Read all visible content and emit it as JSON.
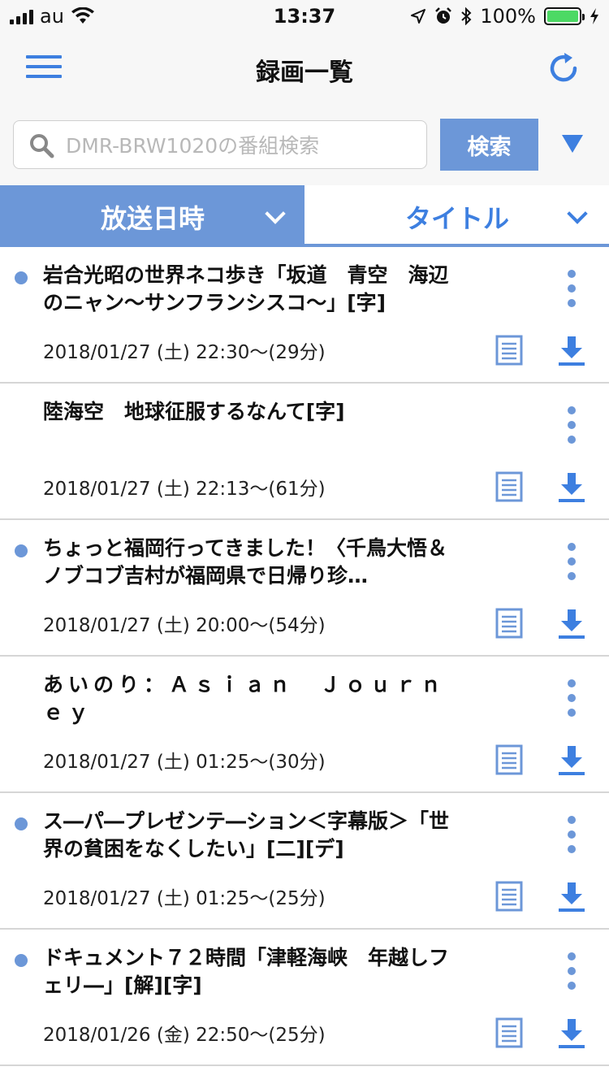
{
  "status": {
    "carrier": "au",
    "time": "13:37",
    "battery": "100%",
    "battery_level": 1.0
  },
  "nav": {
    "title": "録画一覧"
  },
  "search": {
    "placeholder": "DMR-BRW1020の番組検索",
    "button_label": "検索"
  },
  "sort": {
    "primary_label": "放送日時",
    "secondary_label": "タイトル"
  },
  "colors": {
    "accent": "#6c97d8",
    "icon_blue": "#3d7fe0",
    "battery_green": "#4cd964"
  },
  "recordings": [
    {
      "title": "岩合光昭の世界ネコ歩き「坂道　青空　海辺のニャン〜サンフランシスコ〜」[字]",
      "date": "2018/01/27 (土)  22:30〜(29分)",
      "unwatched": true
    },
    {
      "title": "陸海空　地球征服するなんて[字]",
      "date": "2018/01/27 (土)  22:13〜(61分)",
      "unwatched": false
    },
    {
      "title": "ちょっと福岡行ってきました！〈千鳥大悟＆ノブコブ吉村が福岡県で日帰り珍…",
      "date": "2018/01/27 (土)  20:00〜(54分)",
      "unwatched": true
    },
    {
      "title": "あいのり：Ａｓｉａｎ　Ｊｏｕｒｎｅｙ",
      "date": "2018/01/27 (土)  01:25〜(30分)",
      "unwatched": false
    },
    {
      "title": "ス―パ―プレゼンテ―ション＜字幕版＞「世界の貧困をなくしたい」[二][デ]",
      "date": "2018/01/27 (土)  01:25〜(25分)",
      "unwatched": true
    },
    {
      "title": "ドキュメント７２時間「津軽海峡　年越しフェリ―」[解][字]",
      "date": "2018/01/26 (金)  22:50〜(25分)",
      "unwatched": true
    }
  ]
}
